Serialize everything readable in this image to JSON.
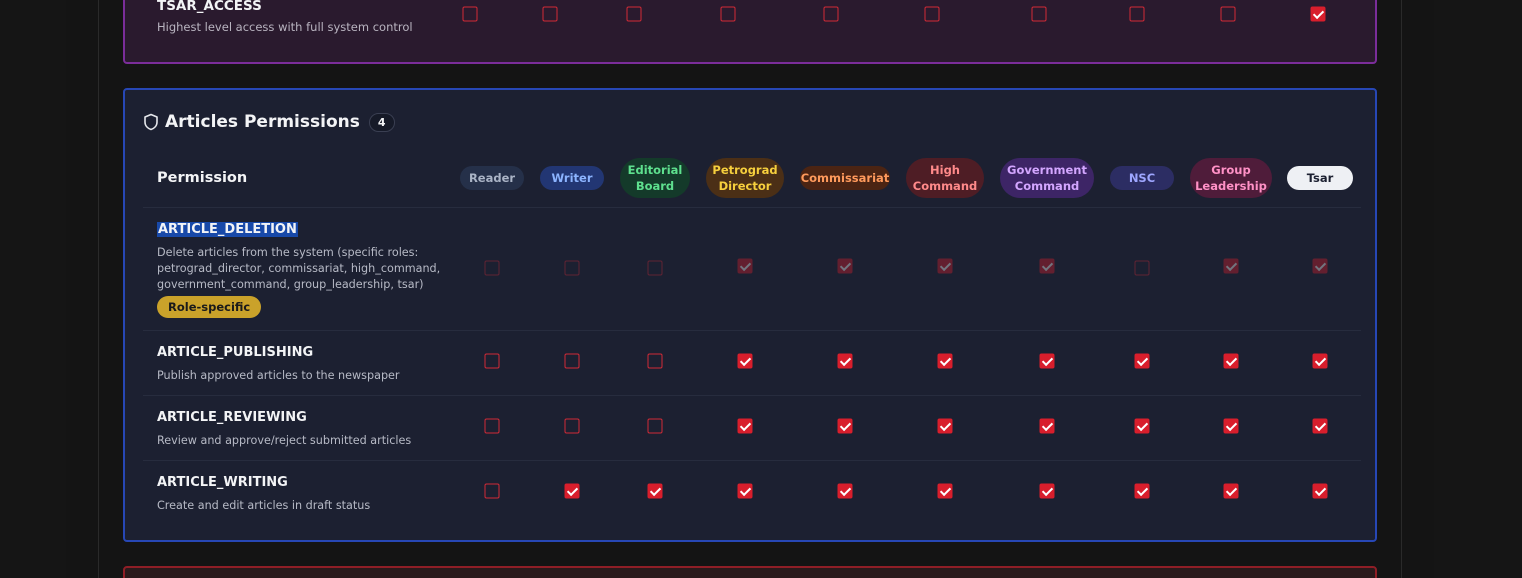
{
  "tsar_section": {
    "permission_name": "TSAR_ACCESS",
    "permission_desc": "Highest level access with full system control",
    "checks": [
      false,
      false,
      false,
      false,
      false,
      false,
      false,
      false,
      false,
      true
    ]
  },
  "section": {
    "title": "Articles Permissions",
    "count": "4",
    "permission_header": "Permission",
    "icon": "shield-icon"
  },
  "roles": [
    {
      "id": "reader",
      "label": "Reader",
      "bg": "#253049",
      "fg": "#aab4c6"
    },
    {
      "id": "writer",
      "label": "Writer",
      "bg": "#223673",
      "fg": "#8cb4ff"
    },
    {
      "id": "editorial-board",
      "label": "Editorial\nBoard",
      "bg": "#143a2a",
      "fg": "#5ee08e"
    },
    {
      "id": "petrograd-director",
      "label": "Petrograd\nDirector",
      "bg": "#4b2f16",
      "fg": "#f6cf3d"
    },
    {
      "id": "commissariat",
      "label": "Commissariat",
      "bg": "#4b2413",
      "fg": "#ff9a5c"
    },
    {
      "id": "high-command",
      "label": "High\nCommand",
      "bg": "#4e1d25",
      "fg": "#ff8a8a"
    },
    {
      "id": "government-command",
      "label": "Government\nCommand",
      "bg": "#3d2566",
      "fg": "#d3a6ff"
    },
    {
      "id": "nsc",
      "label": "NSC",
      "bg": "#2c2d63",
      "fg": "#9ea6ff"
    },
    {
      "id": "group-leadership",
      "label": "Group\nLeadership",
      "bg": "#4f1c3a",
      "fg": "#ff91c6"
    },
    {
      "id": "tsar",
      "label": "Tsar",
      "bg": "#eef0f4",
      "fg": "#1c2031"
    }
  ],
  "permissions": [
    {
      "name": "ARTICLE_DELETION",
      "desc_lines": [
        "Delete articles from the system (specific roles:",
        "petrograd_director, commissariat, high_command,",
        "government_command, group_leadership, tsar)"
      ],
      "tag": "Role-specific",
      "disabled": true,
      "checks": [
        false,
        false,
        false,
        true,
        true,
        true,
        true,
        false,
        true,
        true
      ]
    },
    {
      "name": "ARTICLE_PUBLISHING",
      "desc_lines": [
        "Publish approved articles to the newspaper"
      ],
      "checks": [
        false,
        false,
        false,
        true,
        true,
        true,
        true,
        true,
        true,
        true
      ]
    },
    {
      "name": "ARTICLE_REVIEWING",
      "desc_lines": [
        "Review and approve/reject submitted articles"
      ],
      "checks": [
        false,
        false,
        false,
        true,
        true,
        true,
        true,
        true,
        true,
        true
      ]
    },
    {
      "name": "ARTICLE_WRITING",
      "desc_lines": [
        "Create and edit articles in draft status"
      ],
      "checks": [
        false,
        true,
        true,
        true,
        true,
        true,
        true,
        true,
        true,
        true
      ]
    }
  ]
}
